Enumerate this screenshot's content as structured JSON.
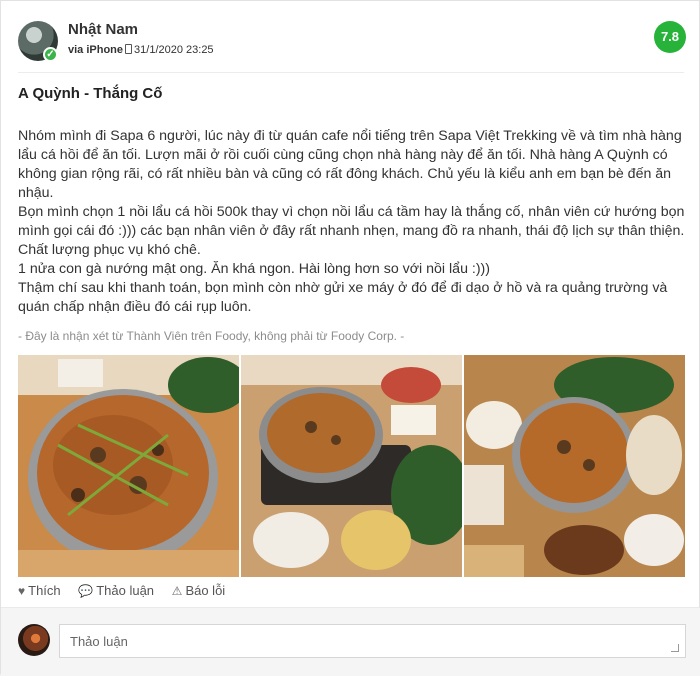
{
  "user": {
    "name": "Nhật Nam",
    "via": "via iPhone",
    "timestamp": "31/1/2020 23:25"
  },
  "score": "7.8",
  "review": {
    "title": "A Quỳnh - Thắng Cố",
    "paragraphs": [
      "Nhóm mình đi Sapa 6 người, lúc này đi từ quán cafe nổi tiếng trên Sapa Việt Trekking về và tìm nhà hàng lẩu cá hồi để ăn tối. Lượn mãi ở rồi cuối cùng cũng chọn nhà hàng này để ăn tối. Nhà hàng A Quỳnh có không gian rộng rãi, có rất nhiều bàn và cũng có rất đông khách. Chủ yếu là kiểu anh em bạn bè đến ăn nhậu.",
      "Bọn mình chọn 1 nồi lẩu cá hồi 500k thay vì chọn nồi lẩu cá tầm hay là thắng cố, nhân viên cứ hướng bọn mình gọi cái đó :))) các bạn nhân viên ở đây rất nhanh nhẹn, mang đồ ra nhanh, thái độ lịch sự thân thiện. Chất lượng phục vụ khó chê.",
      "1 nửa con gà nướng mật ong. Ăn khá ngon. Hài lòng hơn so với nồi lẩu :)))",
      "Thậm chí sau khi thanh toán, bọn mình còn nhờ gửi xe máy ở đó để đi dạo ở hồ và ra quảng trường và quán chấp nhận điều đó cái rụp luôn."
    ],
    "disclaimer": "- Đây là nhận xét từ Thành Viên trên Foody, không phải từ Foody Corp. -"
  },
  "actions": {
    "like": "Thích",
    "discuss": "Thảo luận",
    "report": "Báo lỗi"
  },
  "comment": {
    "placeholder": "Thảo luận"
  },
  "colors": {
    "score_bg": "#27b33a",
    "verified": "#3cb44b"
  },
  "icons": [
    "verified-check-icon",
    "phone-icon",
    "heart-icon",
    "speech-bubble-icon",
    "warning-icon",
    "resize-grip-icon"
  ]
}
